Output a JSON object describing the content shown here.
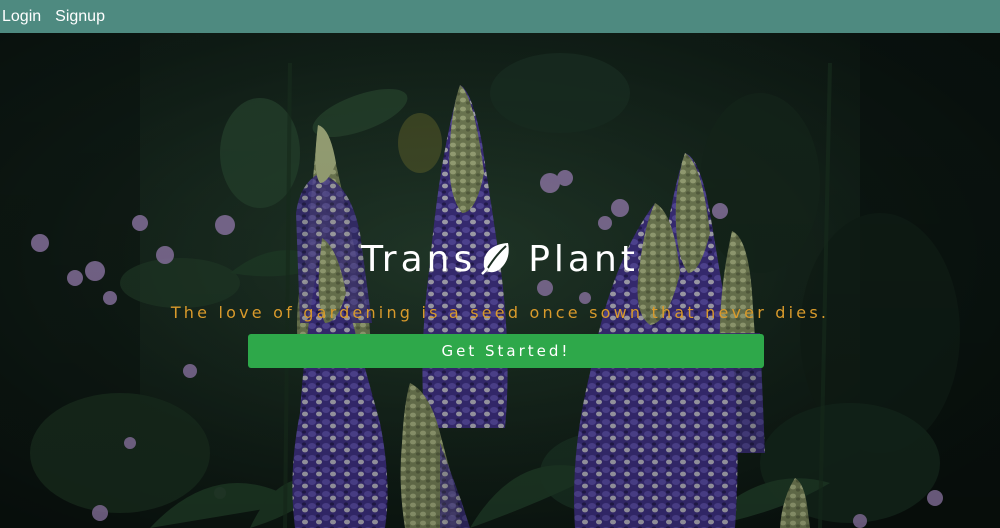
{
  "navbar": {
    "links": [
      {
        "label": "Login"
      },
      {
        "label": "Signup"
      }
    ]
  },
  "hero": {
    "brand_left": "Trans",
    "brand_icon": "leaf-icon",
    "brand_right": "Plant",
    "tagline": "The love of gardening is a seed once sown that never dies.",
    "cta_label": "Get Started!"
  },
  "colors": {
    "navbar_bg": "#4e8a80",
    "tagline": "#d99a2b",
    "cta_bg": "#2ea84a",
    "text": "#ffffff"
  }
}
